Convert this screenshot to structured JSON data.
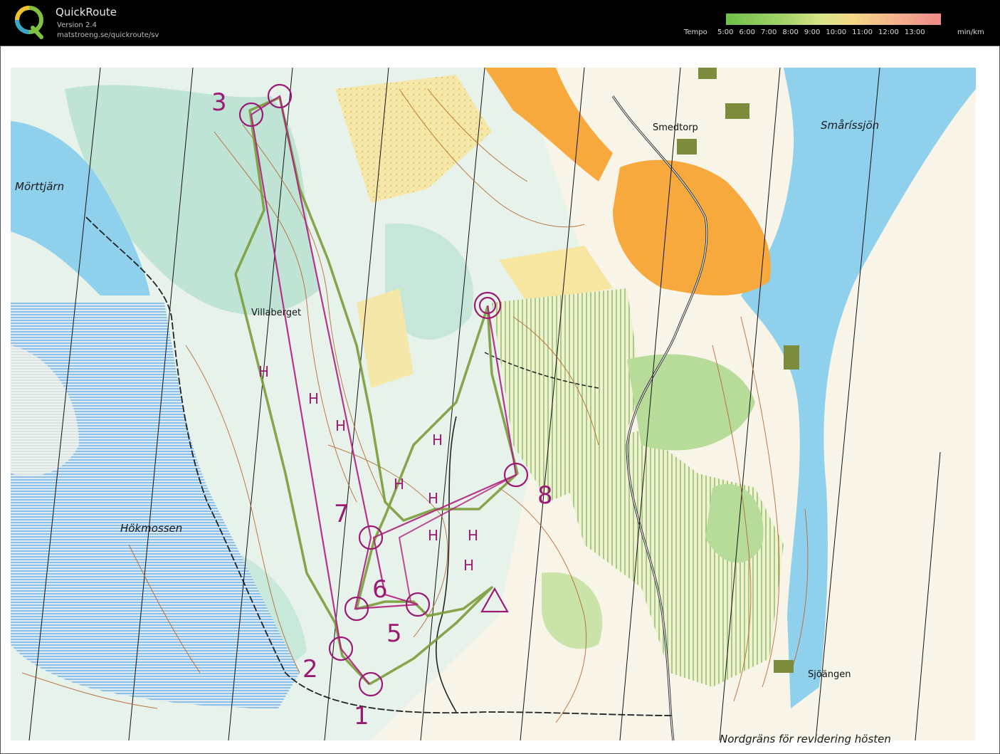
{
  "app": {
    "title": "QuickRoute",
    "version": "Version 2.4",
    "url": "matstroeng.se/quickroute/sv"
  },
  "tempo": {
    "label": "Tempo",
    "ticks": [
      "5:00",
      "6:00",
      "7:00",
      "8:00",
      "9:00",
      "10:00",
      "11:00",
      "12:00",
      "13:00"
    ],
    "unit": "min/km",
    "gradient_colors": [
      "#6fbf4a",
      "#a7d36a",
      "#d9e48a",
      "#f2d985",
      "#f4b38c",
      "#f08a8a"
    ]
  },
  "map": {
    "place_names": {
      "morttjarn": "Mörttjärn",
      "hokmossen": "Hökmossen",
      "villaberget": "Villaberget",
      "smedtorp": "Smedtorp",
      "smarissjon": "Småríssjön",
      "sjoangen": "Sjöängen",
      "nordgrans": "Nordgräns för revidering hösten"
    },
    "controls": [
      "1",
      "2",
      "3",
      "5",
      "6",
      "7",
      "8"
    ],
    "h_marker": "H",
    "colors": {
      "water": "#8fd0ec",
      "marsh": "#a8c8e6",
      "forest_light": "#c9e7d8",
      "open_land": "#f7c25a",
      "rough_open": "#f6e6a0",
      "green": "#b7dc9a",
      "contour": "#b5642a",
      "course": "#b0207e",
      "route": "#7a9c3a"
    }
  }
}
